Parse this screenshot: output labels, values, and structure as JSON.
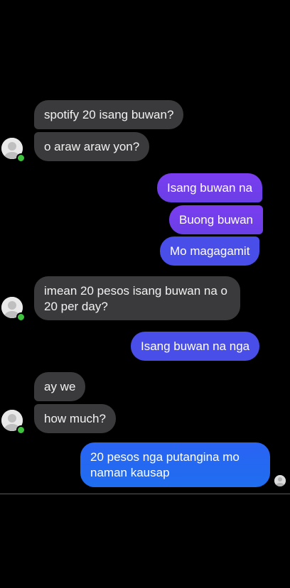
{
  "messages": [
    {
      "id": "m1",
      "text": "spotify 20 isang buwan?"
    },
    {
      "id": "m2",
      "text": "o araw araw yon?"
    },
    {
      "id": "m3",
      "text": "Isang buwan na"
    },
    {
      "id": "m4",
      "text": "Buong buwan"
    },
    {
      "id": "m5",
      "text": "Mo magagamit"
    },
    {
      "id": "m6",
      "text": "imean 20 pesos isang buwan na o 20 per day?"
    },
    {
      "id": "m7",
      "text": "Isang buwan na nga"
    },
    {
      "id": "m8",
      "text": "ay we"
    },
    {
      "id": "m9",
      "text": "how much?"
    },
    {
      "id": "m10",
      "text": "20 pesos nga putangina mo naman kausap"
    }
  ],
  "colors": {
    "background": "#000000",
    "incoming_bubble": "#3a3a3c",
    "outgoing_purple": "#7a3df0",
    "outgoing_indigo": "#4a4ee8",
    "outgoing_blue": "#1f6ef0",
    "online_dot": "#3ec23e"
  },
  "icons": {
    "avatar": "default-profile-avatar-icon",
    "online": "online-status-dot-icon",
    "seen": "seen-receipt-avatar-icon"
  }
}
